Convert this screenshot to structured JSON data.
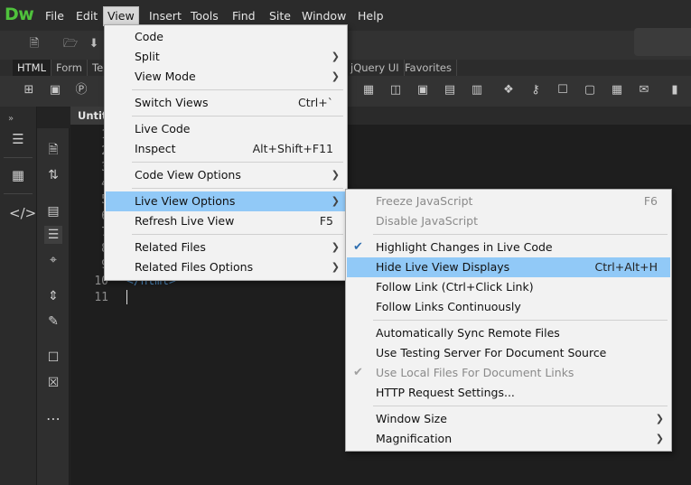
{
  "app": {
    "logo": "Dw",
    "menubar": [
      {
        "label": "File"
      },
      {
        "label": "Edit"
      },
      {
        "label": "View"
      },
      {
        "label": "Insert"
      },
      {
        "label": "Tools"
      },
      {
        "label": "Find"
      },
      {
        "label": "Site"
      },
      {
        "label": "Window"
      },
      {
        "label": "Help"
      }
    ]
  },
  "insert_panel": {
    "tabs": [
      {
        "label": "HTML"
      },
      {
        "label": "Form"
      },
      {
        "label": "Te"
      },
      {
        "label": "jQuery UI"
      },
      {
        "label": "Favorites"
      }
    ]
  },
  "document": {
    "tab_title": "Untitled",
    "line_numbers": [
      "1",
      "2",
      "3",
      "4",
      "5",
      "6",
      "7",
      "8",
      "9",
      "10",
      "11"
    ],
    "visible_code_line_10": "</html>"
  },
  "view_menu": {
    "items": [
      {
        "label": "Code",
        "shortcut": "",
        "submenu": false
      },
      {
        "label": "Split",
        "shortcut": "",
        "submenu": true
      },
      {
        "label": "View Mode",
        "shortcut": "",
        "submenu": true
      },
      {
        "label": "Switch Views",
        "shortcut": "Ctrl+`",
        "submenu": false
      },
      {
        "label": "Live Code",
        "shortcut": "",
        "submenu": false
      },
      {
        "label": "Inspect",
        "shortcut": "Alt+Shift+F11",
        "submenu": false
      },
      {
        "label": "Code View Options",
        "shortcut": "",
        "submenu": true
      },
      {
        "label": "Live View Options",
        "shortcut": "",
        "submenu": true
      },
      {
        "label": "Refresh Live View",
        "shortcut": "F5",
        "submenu": false
      },
      {
        "label": "Related Files",
        "shortcut": "",
        "submenu": true
      },
      {
        "label": "Related Files Options",
        "shortcut": "",
        "submenu": true
      }
    ]
  },
  "live_view_submenu": {
    "items": [
      {
        "label": "Freeze JavaScript",
        "shortcut": "F6",
        "disabled": true
      },
      {
        "label": "Disable JavaScript",
        "shortcut": "",
        "disabled": true
      },
      {
        "label": "Highlight Changes in Live Code",
        "shortcut": "",
        "checked": true
      },
      {
        "label": "Hide Live View Displays",
        "shortcut": "Ctrl+Alt+H",
        "highlighted": true
      },
      {
        "label": "Follow Link (Ctrl+Click Link)",
        "shortcut": ""
      },
      {
        "label": "Follow Links Continuously",
        "shortcut": ""
      },
      {
        "label": "Automatically Sync Remote Files",
        "shortcut": ""
      },
      {
        "label": "Use Testing Server For Document Source",
        "shortcut": ""
      },
      {
        "label": "Use Local Files For Document Links",
        "shortcut": "",
        "disabled": true,
        "checked": true
      },
      {
        "label": "HTTP Request Settings...",
        "shortcut": ""
      },
      {
        "label": "Window Size",
        "shortcut": "",
        "submenu": true
      },
      {
        "label": "Magnification",
        "shortcut": "",
        "submenu": true
      }
    ]
  },
  "colors": {
    "accent_logo": "#4fc23c",
    "menu_highlight": "#91c9f7",
    "code_tag": "#4f8fc9"
  }
}
